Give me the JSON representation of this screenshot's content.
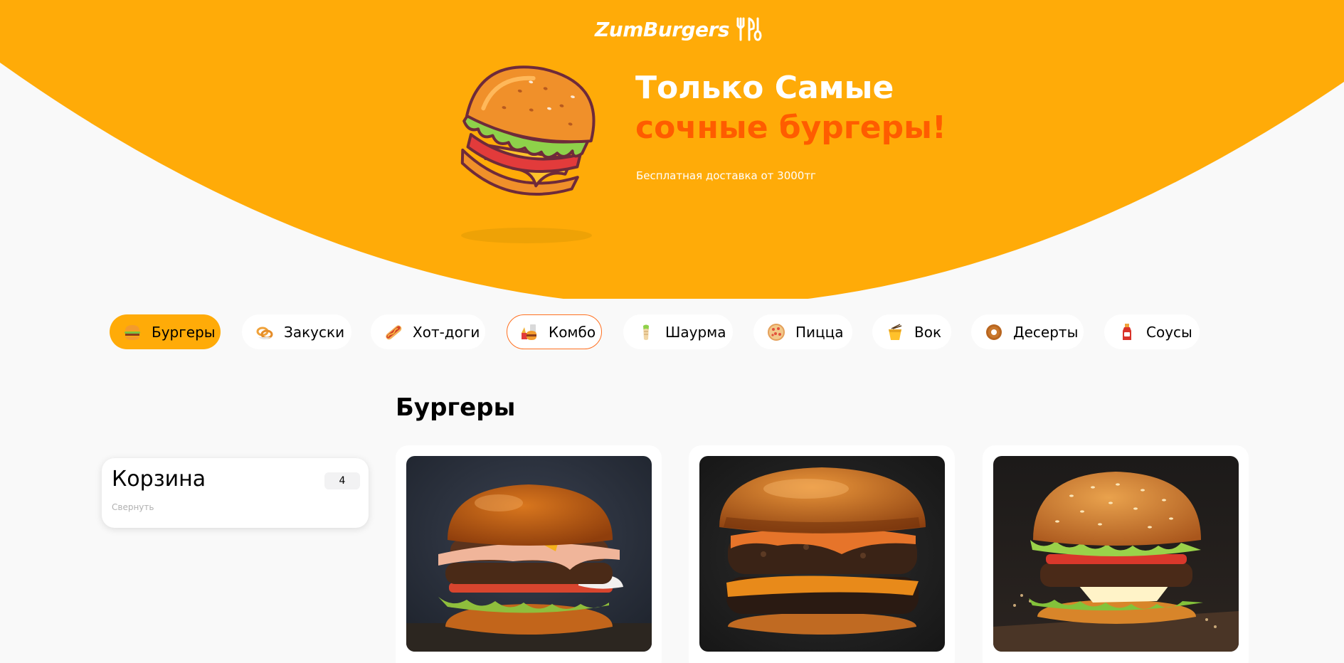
{
  "brand": {
    "name": "ZumBurgers",
    "logo_icon": "fork-knife-icon"
  },
  "hero": {
    "title_line1": "Только Самые",
    "title_line2": "сочные бургеры!",
    "subtitle": "Бесплатная доставка от 3000тг",
    "accent_color": "#ffab08",
    "highlight_color": "#ff5c00"
  },
  "categories": [
    {
      "label": "Бургеры",
      "icon": "burger-icon",
      "state": "active"
    },
    {
      "label": "Закуски",
      "icon": "onion-rings-icon"
    },
    {
      "label": "Хот-доги",
      "icon": "hot-dog-icon"
    },
    {
      "label": "Комбо",
      "icon": "combo-icon",
      "state": "outlined"
    },
    {
      "label": "Шаурма",
      "icon": "shawarma-icon"
    },
    {
      "label": "Пицца",
      "icon": "pizza-icon"
    },
    {
      "label": "Вок",
      "icon": "wok-icon"
    },
    {
      "label": "Десерты",
      "icon": "donut-icon"
    },
    {
      "label": "Соусы",
      "icon": "sauce-icon"
    }
  ],
  "section": {
    "title": "Бургеры"
  },
  "basket": {
    "title": "Корзина",
    "count": "4",
    "collapse_label": "Свернуть"
  },
  "products": [
    {
      "photo": "double-burger-photo"
    },
    {
      "photo": "cheese-burger-photo"
    },
    {
      "photo": "classic-burger-photo"
    }
  ]
}
